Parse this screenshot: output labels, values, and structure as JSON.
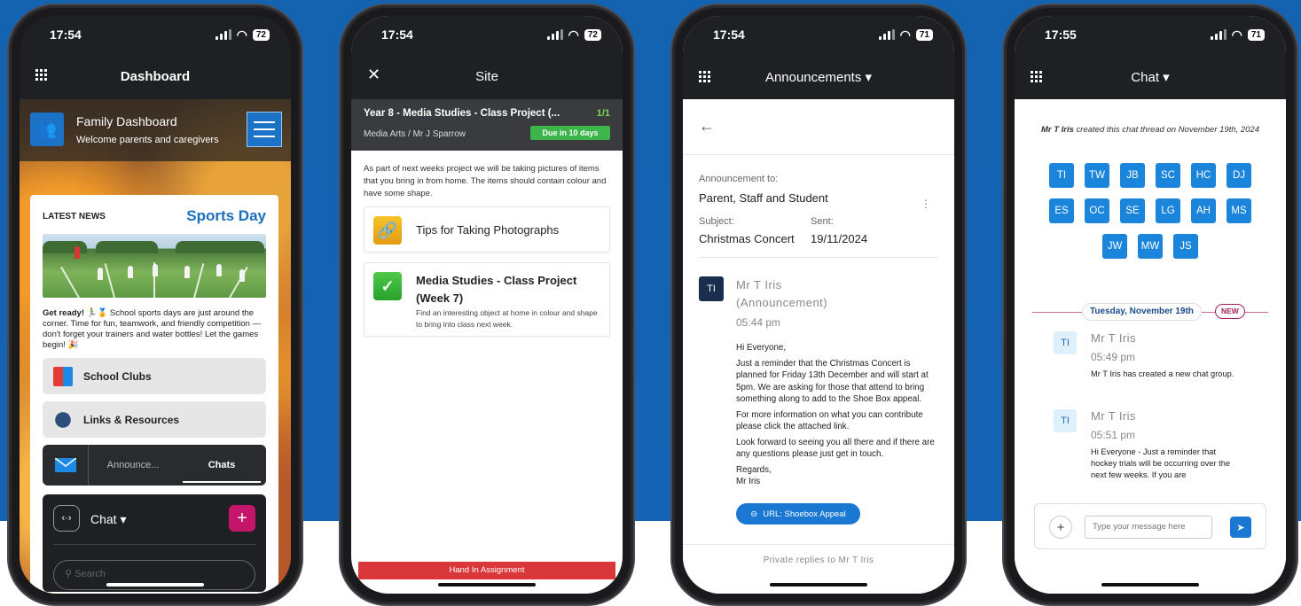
{
  "phones": [
    {
      "status": {
        "time": "17:54",
        "battery": "72"
      },
      "title": "Dashboard",
      "header": {
        "title": "Family Dashboard",
        "subtitle": "Welcome parents and caregivers"
      },
      "news": {
        "label": "LATEST NEWS",
        "heading": "Sports Day",
        "lead": "Get ready!",
        "body": " 🏃‍♂️🏅 School sports days are just around the corner. Time for fun, teamwork, and friendly competition — don't forget your trainers and water bottles! Let the games begin! 🎉"
      },
      "buttons": [
        "School Clubs",
        "Links & Resources"
      ],
      "tabs": [
        "Announce...",
        "Chats"
      ],
      "chat": {
        "label": "Chat",
        "plus": "+",
        "search_placeholder": "Search"
      }
    },
    {
      "status": {
        "time": "17:54",
        "battery": "72"
      },
      "title": "Site",
      "assignment": {
        "title": "Year 8 - Media Studies - Class Project (...",
        "count": "1/1",
        "subtitle": "Media Arts / Mr J Sparrow",
        "due": "Due in 10 days"
      },
      "description": "As part of next weeks project we will be taking pictures of items that you bring in from home. The items should contain colour and have some shape.",
      "items": [
        {
          "title": "Tips for Taking Photographs"
        },
        {
          "title": "Media Studies - Class Project (Week 7)",
          "desc": "Find an interesting object at home in colour and shape to bring into class next week."
        }
      ],
      "hand_in": "Hand In Assignment"
    },
    {
      "status": {
        "time": "17:54",
        "battery": "71"
      },
      "title": "Announcements",
      "to_label": "Announcement to:",
      "to_value": "Parent, Staff and Student",
      "subject_label": "Subject:",
      "subject_value": "Christmas Concert",
      "sent_label": "Sent:",
      "sent_value": "19/11/2024",
      "avatar": "TI",
      "author": "Mr T Iris",
      "author_sub": "(Announcement)",
      "time": "05:44 pm",
      "message": [
        "Hi Everyone,",
        "Just a reminder that the Christmas Concert is planned for Friday 13th December and will start at 5pm. We are asking for those that attend to bring something along to add to the Shoe Box appeal.",
        "For more information on what you can contribute please click the attached link.",
        "Look forward to seeing you all there and if there are any questions please just get in touch.",
        "Regards,\nMr Iris"
      ],
      "link": "URL: Shoebox Appeal",
      "private": "Private replies to Mr T Iris"
    },
    {
      "status": {
        "time": "17:55",
        "battery": "71"
      },
      "title": "Chat",
      "created": {
        "name": "Mr T Iris",
        "text": " created this chat thread on November 19th, 2024"
      },
      "chips": [
        "TI",
        "TW",
        "JB",
        "SC",
        "HC",
        "DJ",
        "ES",
        "OC",
        "SE",
        "LG",
        "AH",
        "MS",
        "JW",
        "MW",
        "JS"
      ],
      "date": "Tuesday, November 19th",
      "new_badge": "NEW",
      "messages": [
        {
          "avatar": "TI",
          "name": "Mr T Iris",
          "time": "05:49 pm",
          "text": "Mr T Iris has created a new chat group."
        },
        {
          "avatar": "TI",
          "name": "Mr T Iris",
          "time": "05:51 pm",
          "text": "Hi Everyone - Just a reminder that hockey trials will be occurring over the next few weeks. If you are"
        }
      ],
      "compose_placeholder": "Type your message here"
    }
  ]
}
